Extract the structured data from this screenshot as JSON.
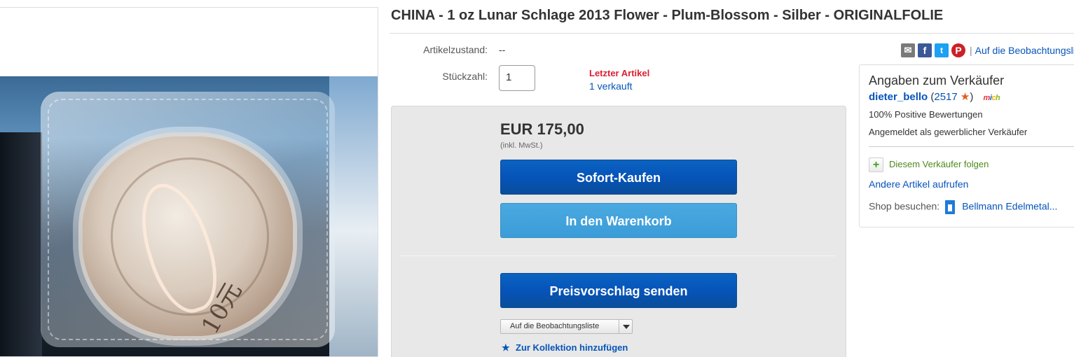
{
  "listing": {
    "title": "CHINA - 1 oz Lunar Schlage 2013 Flower - Plum-Blossom - Silber - ORIGINALFOLIE",
    "image_denomination": "10元"
  },
  "details": {
    "condition_label": "Artikelzustand:",
    "condition_value": "--",
    "quantity_label": "Stückzahl:",
    "quantity_value": "1",
    "last_item": "Letzter Artikel",
    "sold": "1 verkauft"
  },
  "buy": {
    "price": "EUR 175,00",
    "vat_note": "(inkl. MwSt.)",
    "buy_now_label": "Sofort-Kaufen",
    "cart_label": "In den Warenkorb",
    "offer_label": "Preisvorschlag senden",
    "watchlist_label": "Auf die Beobachtungsliste",
    "collection_label": "Zur Kollektion hinzufügen"
  },
  "share": {
    "icons": [
      "mail-icon",
      "facebook-icon",
      "twitter-icon",
      "pinterest-icon"
    ],
    "mail_glyph": "✉",
    "facebook_glyph": "f",
    "twitter_glyph": "t",
    "pinterest_glyph": "P",
    "separator": "|",
    "watch_link": "Auf die Beobachtungsliste"
  },
  "seller": {
    "header": "Angaben zum Verkäufer",
    "username": "dieter_bello",
    "paren_open": "(",
    "score": "2517",
    "star": "★",
    "paren_close": ")",
    "me_badge": [
      "m",
      "i",
      "c",
      "h"
    ],
    "positive": "100% Positive Bewertungen",
    "business": "Angemeldet als gewerblicher Verkäufer",
    "follow_icon": "+",
    "follow": "Diesem Verkäufer folgen",
    "other_items": "Andere Artikel aufrufen",
    "shop_label": "Shop besuchen:",
    "shop_name": "Bellmann Edelmetal..."
  },
  "colors": {
    "link_blue": "#0654ba",
    "button_dark": "#0654ba",
    "button_light": "#3b9cd8",
    "alert_red": "#dd1e31",
    "follow_green": "#4e8a1a",
    "rating_star": "#e55b1c"
  }
}
